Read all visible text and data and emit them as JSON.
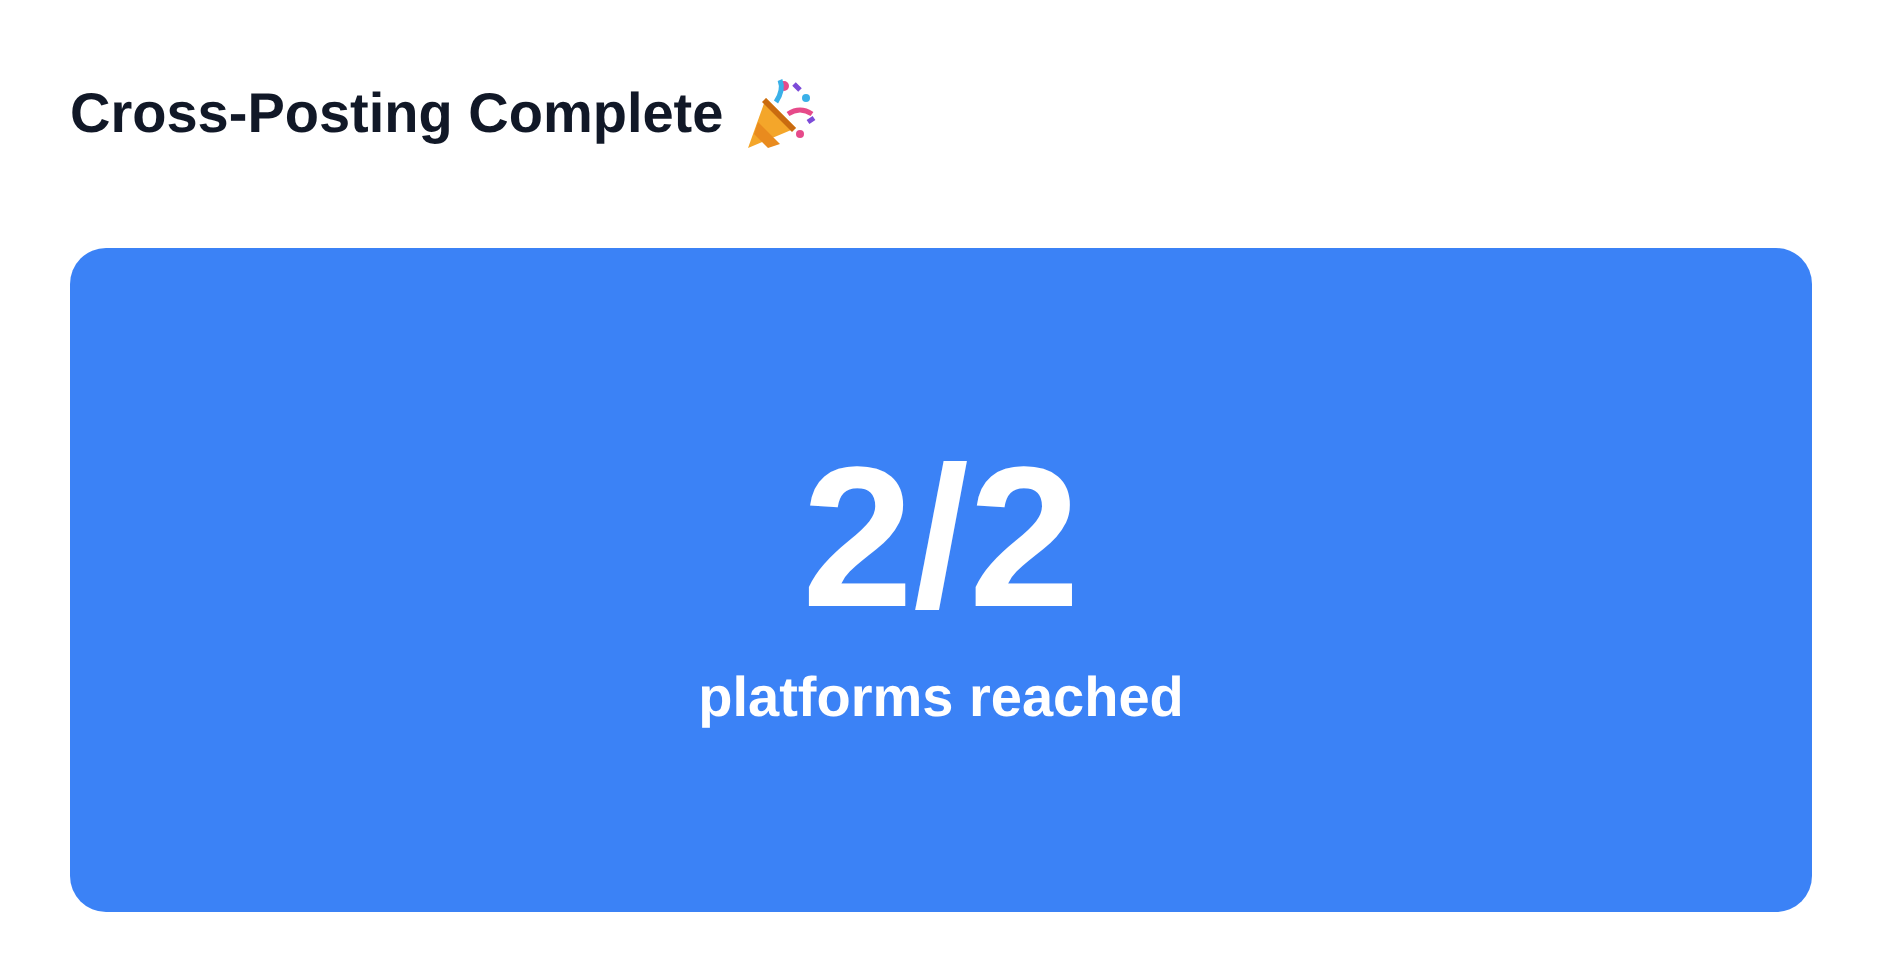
{
  "title": "Cross-Posting Complete",
  "summary": {
    "count": "2/2",
    "caption": "platforms reached"
  }
}
